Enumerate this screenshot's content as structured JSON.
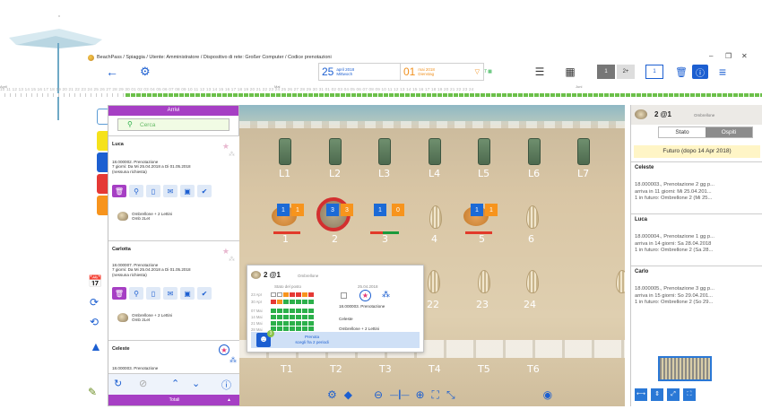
{
  "window": {
    "title": "BeachPass / Spiaggia / Utente: Amministratore / Dispositivo di rete: Großer Computer / Codice prenotazioni",
    "minimize": "–",
    "restore": "❐",
    "close": "✕"
  },
  "toolbar": {
    "date_from": {
      "day": "25",
      "month": "april 2018",
      "weekday": "Mittwoch"
    },
    "date_to": {
      "day": "01",
      "month": "mai 2018",
      "weekday": "Dienstag"
    },
    "days_count": "7",
    "btn_1": "1",
    "btn_2plus": "2+",
    "btn_one": "1"
  },
  "timeline": {
    "month_april": "April",
    "month_mai": "Mai",
    "month_juni": "Juni",
    "days_april": "10 11 12 13 14 15 16 17 18 19 20 21 22 23 24 25 26 27 28 29 30",
    "days_mai": "01 02 03 04 05 06 07 08 09 10 11 12 13 14 15 16 17 18 19 20 21 22 23 24 25 26 27 28 29 30 31",
    "days_juni": "01 02 03 04 05 06 07 08 09 10 11 12 13 14 15 16 17 18 19 20 21 22 23 24"
  },
  "arrivi": {
    "title": "Arrivi",
    "search_placeholder": "Cerca",
    "cards": [
      {
        "name": "Luca",
        "line1": "18.000002. Prenotazione",
        "line2": "7 giorni: Da Mi 25.04.2018 a Di 01.05.2018",
        "line3": "(nessuna richiesta)",
        "item1": "Ombrellone + 2 Lettini",
        "item2": "Omb 2Let"
      },
      {
        "name": "Carlotta",
        "line1": "18.000007. Prenotazione",
        "line2": "7 giorni: Da Mi 25.04.2018 a Di 01.05.2018",
        "line3": "(nessuna richiesta)",
        "item1": "Ombrellone + 2 Lettini",
        "item2": "Omb 2Let"
      },
      {
        "name": "Celeste",
        "line1": "18.000003. Prenotazione"
      }
    ],
    "footer": "Totali"
  },
  "beach": {
    "cabins": [
      "L1",
      "L2",
      "L3",
      "L4",
      "L5",
      "L6",
      "L7"
    ],
    "row1": [
      "1",
      "2",
      "3",
      "4",
      "5",
      "6"
    ],
    "row2": [
      "22",
      "23",
      "24"
    ],
    "row3": [
      "T1",
      "T2",
      "T3",
      "T4",
      "T5",
      "T6"
    ],
    "badges": {
      "a": "1",
      "b": "1",
      "c": "3",
      "d": "3",
      "e": "1",
      "f": "0",
      "g": "1",
      "h": "1"
    }
  },
  "popup": {
    "title": "2 @1",
    "subtitle": "Ombrellone",
    "stato_label": "Stato del posto",
    "date": "25.04.2018",
    "weeks": [
      "23 Apr",
      "30 Apr",
      "07 Mai",
      "14 Mai",
      "21 Mai",
      "28 Mai"
    ],
    "booking": "18.000003. Prenotazione",
    "guest": "Celeste",
    "item": "Ombrellone + 2 Lettini",
    "badge": "3",
    "button_line1": "Prenota",
    "button_line2": "scegli fra 2 periodi"
  },
  "right": {
    "title": "2 @1",
    "subtitle": "Ombrellone",
    "tab_stato": "Stato",
    "tab_ospiti": "Ospiti",
    "future": "Futuro (dopo 14 Apr 2018)",
    "guests": [
      {
        "name": "Celeste",
        "l1": "18.000003., Prenotazione 2 gg p...",
        "l2": "arriva in 11 giorni: Mi 25.04.201...",
        "l3": "1 in futuro: Ombrellone 2 (Mi 25..."
      },
      {
        "name": "Luca",
        "l1": "18.000004., Prenotazione 1 gg p...",
        "l2": "arriva in 14 giorni: Sa 28.04.2018",
        "l3": "1 in futuro: Ombrellone 2 (Sa 28..."
      },
      {
        "name": "Carlo",
        "l1": "18.000005., Prenotazione 3 gg p...",
        "l2": "arriva in 15 giorni: So 29.04.201...",
        "l3": "1 in futuro: Ombrellone 2 (So 29..."
      }
    ]
  },
  "colors": {
    "accent": "#1c5fd1",
    "purple": "#a63fc4",
    "orange": "#f0901e",
    "green": "#2bb04a",
    "red": "#e53935"
  }
}
